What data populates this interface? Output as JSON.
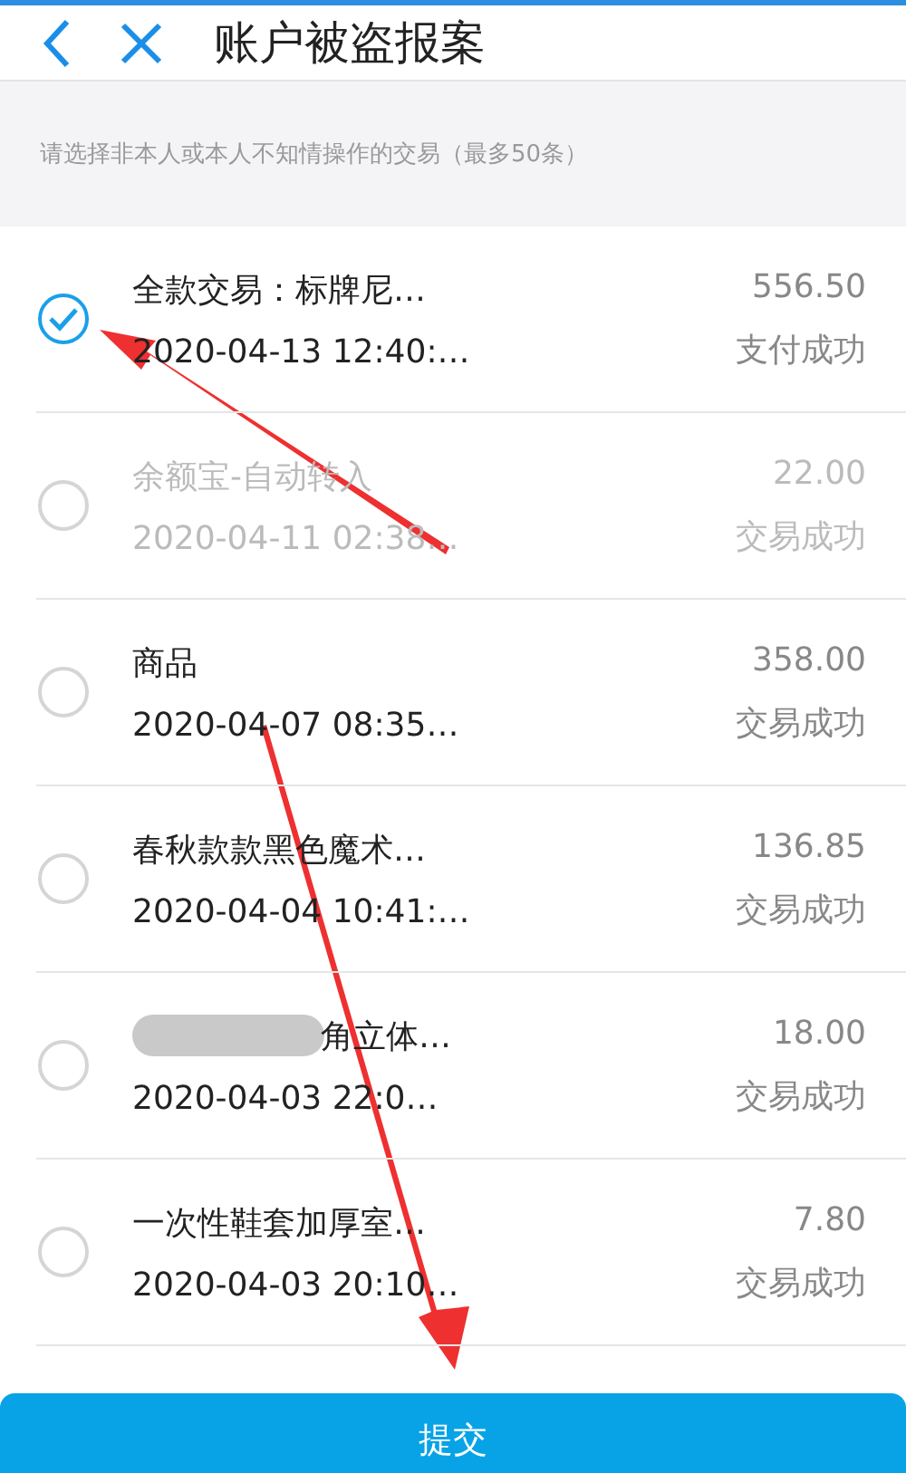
{
  "header": {
    "title": "账户被盗报案"
  },
  "hint": "请选择非本人或本人不知情操作的交易（最多50条）",
  "transactions": [
    {
      "title": "全款交易：标牌尼…",
      "time": "2020-04-13 12:40:…",
      "amount": "556.50",
      "status": "支付成功",
      "selected": true,
      "disabled": false,
      "redacted": false
    },
    {
      "title": "余额宝-自动转入",
      "time": "2020-04-11 02:38…",
      "amount": "22.00",
      "status": "交易成功",
      "selected": false,
      "disabled": true,
      "redacted": false
    },
    {
      "title": "商品",
      "time": "2020-04-07 08:35…",
      "amount": "358.00",
      "status": "交易成功",
      "selected": false,
      "disabled": false,
      "redacted": false
    },
    {
      "title": "春秋款款黑色魔术…",
      "time": "2020-04-04 10:41:…",
      "amount": "136.85",
      "status": "交易成功",
      "selected": false,
      "disabled": false,
      "redacted": false
    },
    {
      "title": "角立体…",
      "time": "2020-04-03 22:0…",
      "amount": "18.00",
      "status": "交易成功",
      "selected": false,
      "disabled": false,
      "redacted": true
    },
    {
      "title": "一次性鞋套加厚室…",
      "time": "2020-04-03 20:10…",
      "amount": "7.80",
      "status": "交易成功",
      "selected": false,
      "disabled": false,
      "redacted": false
    }
  ],
  "submit_button": "提交"
}
